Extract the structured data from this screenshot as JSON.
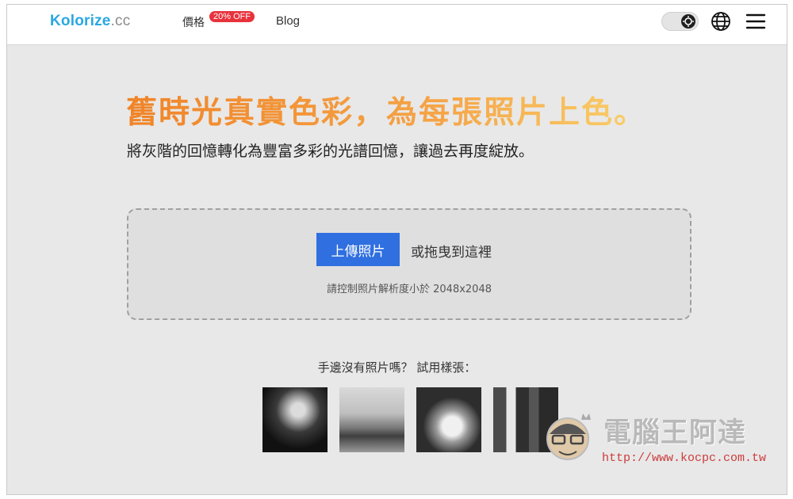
{
  "nav": {
    "logo_main": "Kolorize",
    "logo_tld": ".cc",
    "pricing": "價格",
    "pricing_badge": "20% OFF",
    "blog": "Blog",
    "icons": [
      "theme-toggle-icon",
      "globe-icon",
      "hamburger-menu-icon"
    ]
  },
  "hero": {
    "title": "舊時光真實色彩，為每張照片上色。",
    "subtitle": "將灰階的回憶轉化為豐富多彩的光譜回憶，讓過去再度綻放。"
  },
  "upload": {
    "button": "上傳照片",
    "drag_text": "或拖曳到這裡",
    "hint": "請控制照片解析度小於 2048x2048"
  },
  "samples": {
    "label": "手邊沒有照片嗎？ 試用樣張：",
    "items": [
      "sample-portrait",
      "sample-vintage-car",
      "sample-cat",
      "sample-city-street"
    ]
  },
  "watermark": {
    "text": "電腦王阿達",
    "url": "http://www.kocpc.com.tw"
  },
  "colors": {
    "accent_blue": "#2f6fe0",
    "logo_blue": "#2aa7e2",
    "title_orange": "#f08428",
    "badge_red": "#e8323c"
  }
}
